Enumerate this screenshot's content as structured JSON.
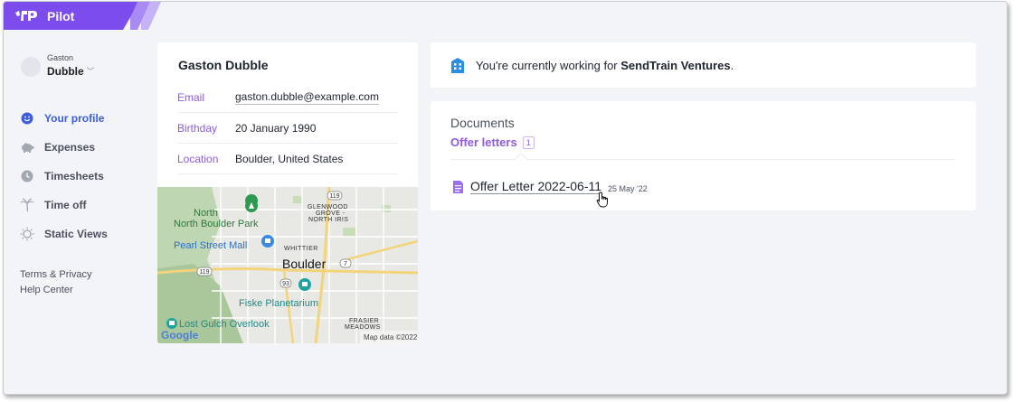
{
  "app": {
    "name": "Pilot"
  },
  "user": {
    "first_name": "Gaston",
    "last_name": "Dubble"
  },
  "sidebar": {
    "items": [
      {
        "label": "Your profile",
        "icon": "smiley-icon",
        "active": true
      },
      {
        "label": "Expenses",
        "icon": "piggy-bank-icon",
        "active": false
      },
      {
        "label": "Timesheets",
        "icon": "clock-icon",
        "active": false
      },
      {
        "label": "Time off",
        "icon": "palm-tree-icon",
        "active": false
      },
      {
        "label": "Static Views",
        "icon": "sun-icon",
        "active": false
      }
    ],
    "footer": {
      "terms": "Terms & Privacy",
      "help": "Help Center"
    }
  },
  "profile": {
    "name": "Gaston Dubble",
    "email_label": "Email",
    "email": "gaston.dubble@example.com",
    "birthday_label": "Birthday",
    "birthday": "20 January 1990",
    "location_label": "Location",
    "location": "Boulder, United States"
  },
  "map": {
    "labels": {
      "north_boulder_park": "North Boulder Park",
      "pearl_street": "Pearl Street Mall",
      "whittier": "WHITTIER",
      "boulder": "Boulder",
      "glenwood": "GLENWOOD GROVE - NORTH IRIS",
      "fiske": "Fiske Planetarium",
      "lost_gulch": "Lost Gulch Overlook",
      "frasier": "FRASIER MEADOWS",
      "google": "Google",
      "attribution": "Map data ©2022",
      "route_119_top": "119",
      "route_119_left": "119",
      "route_93": "93",
      "route_7": "7"
    }
  },
  "notice": {
    "prefix": "You're currently working for ",
    "company": "SendTrain Ventures",
    "suffix": "."
  },
  "documents": {
    "title": "Documents",
    "tab_label": "Offer letters",
    "tab_count": "1",
    "items": [
      {
        "name": "Offer Letter 2022-06-11",
        "date": "25 May '22"
      }
    ]
  },
  "colors": {
    "brand": "#7c4dec",
    "accent": "#8e5ae6",
    "active_nav": "#3d5ee0",
    "background": "#f3f4f7"
  }
}
